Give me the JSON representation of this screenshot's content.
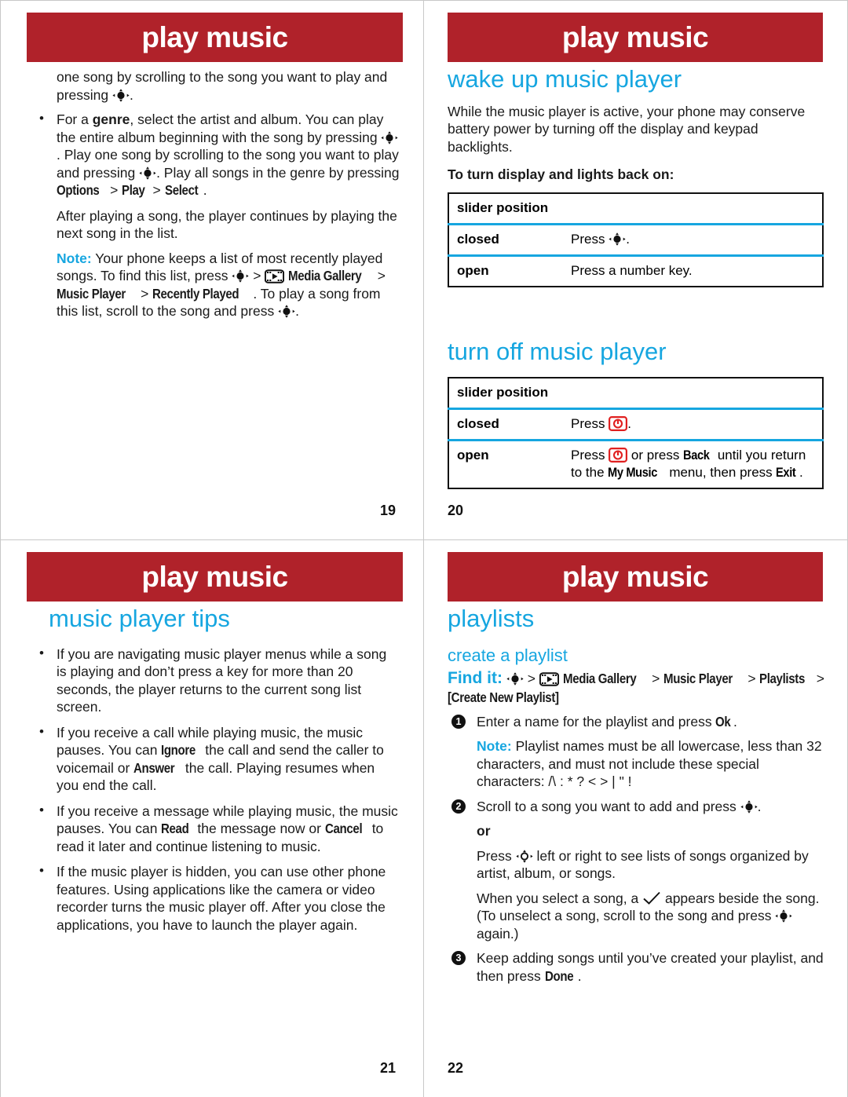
{
  "document": {
    "title": "play music",
    "colors": {
      "banner_red": "#b0222a",
      "heading_cyan": "#16a6e0",
      "rule_cyan": "#16a6e0",
      "power_key_red": "#e02020"
    }
  },
  "pages": [
    {
      "number": "19",
      "banner": "play music",
      "blocks": [
        {
          "kind": "paragraph",
          "runs": [
            {
              "t": "text",
              "v": "one song by scrolling to the song you want to play and pressing "
            },
            {
              "t": "icon",
              "v": "nav-key-icon"
            },
            {
              "t": "text",
              "v": "."
            }
          ]
        },
        {
          "kind": "bullet",
          "runs": [
            {
              "t": "text",
              "v": "For a "
            },
            {
              "t": "bold",
              "v": "genre"
            },
            {
              "t": "text",
              "v": ", select the artist and album. You can play the entire album beginning with the song by pressing "
            },
            {
              "t": "icon",
              "v": "nav-key-icon"
            },
            {
              "t": "text",
              "v": ". Play one song by scrolling to the song you want to play and pressing "
            },
            {
              "t": "icon",
              "v": "nav-key-icon"
            },
            {
              "t": "text",
              "v": ". Play all songs in the genre by pressing "
            },
            {
              "t": "keycap",
              "v": "Options"
            },
            {
              "t": "text",
              "v": " > "
            },
            {
              "t": "keycap",
              "v": "Play"
            },
            {
              "t": "text",
              "v": " > "
            },
            {
              "t": "keycap",
              "v": "Select"
            },
            {
              "t": "text",
              "v": "."
            }
          ]
        },
        {
          "kind": "paragraph-indent",
          "runs": [
            {
              "t": "text",
              "v": "After playing a song, the player continues by playing the next song in the list."
            }
          ]
        },
        {
          "kind": "paragraph-indent",
          "runs": [
            {
              "t": "note",
              "v": "Note:"
            },
            {
              "t": "text",
              "v": " Your phone keeps a list of most recently played songs. To find this list, press "
            },
            {
              "t": "icon",
              "v": "nav-key-icon"
            },
            {
              "t": "text",
              "v": " > "
            },
            {
              "t": "icon",
              "v": "media-gallery-icon"
            },
            {
              "t": "text",
              "v": " "
            },
            {
              "t": "keycap",
              "v": "Media Gallery"
            },
            {
              "t": "text",
              "v": " > "
            },
            {
              "t": "keycap",
              "v": "Music Player"
            },
            {
              "t": "text",
              "v": " > "
            },
            {
              "t": "keycap",
              "v": "Recently Played"
            },
            {
              "t": "text",
              "v": ". To play a song from this list, scroll to the song and press "
            },
            {
              "t": "icon",
              "v": "nav-key-icon"
            },
            {
              "t": "text",
              "v": "."
            }
          ]
        }
      ]
    },
    {
      "number": "20",
      "banner": "play music",
      "heading1": "wake up music player",
      "intro": "While the music player is active, your phone may conserve battery power by turning off the display and keypad backlights.",
      "subhead": "To turn display and lights back on:",
      "table1": {
        "header": "slider position",
        "rows": [
          {
            "label": "closed",
            "runs": [
              {
                "t": "text",
                "v": "Press "
              },
              {
                "t": "icon",
                "v": "nav-key-icon"
              },
              {
                "t": "text",
                "v": "."
              }
            ]
          },
          {
            "label": "open",
            "runs": [
              {
                "t": "text",
                "v": "Press a number key."
              }
            ]
          }
        ]
      },
      "heading2": "turn off music player",
      "table2": {
        "header": "slider position",
        "rows": [
          {
            "label": "closed",
            "runs": [
              {
                "t": "text",
                "v": "Press "
              },
              {
                "t": "icon",
                "v": "power-key-icon"
              },
              {
                "t": "text",
                "v": "."
              }
            ]
          },
          {
            "label": "open",
            "runs": [
              {
                "t": "text",
                "v": "Press "
              },
              {
                "t": "icon",
                "v": "power-key-icon"
              },
              {
                "t": "text",
                "v": " or press "
              },
              {
                "t": "keycap",
                "v": "Back"
              },
              {
                "t": "text",
                "v": " until you return to the "
              },
              {
                "t": "keycap",
                "v": "My Music"
              },
              {
                "t": "text",
                "v": " menu, then press "
              },
              {
                "t": "keycap",
                "v": "Exit"
              },
              {
                "t": "text",
                "v": "."
              }
            ]
          }
        ]
      }
    },
    {
      "number": "21",
      "banner": "play music",
      "heading1": "music player tips",
      "bullets": [
        {
          "runs": [
            {
              "t": "text",
              "v": "If you are navigating music player menus while a song is playing and don’t press a key for more than 20 seconds, the player returns to the current song list screen."
            }
          ]
        },
        {
          "runs": [
            {
              "t": "text",
              "v": "If you receive a call while playing music, the music pauses. You can "
            },
            {
              "t": "keycap",
              "v": "Ignore"
            },
            {
              "t": "text",
              "v": " the call and send the caller to voicemail or "
            },
            {
              "t": "keycap",
              "v": "Answer"
            },
            {
              "t": "text",
              "v": " the call. Playing resumes when you end the call."
            }
          ]
        },
        {
          "runs": [
            {
              "t": "text",
              "v": "If you receive a message while playing music, the music pauses. You can "
            },
            {
              "t": "keycap",
              "v": "Read"
            },
            {
              "t": "text",
              "v": " the message now or "
            },
            {
              "t": "keycap",
              "v": "Cancel"
            },
            {
              "t": "text",
              "v": " to read it later and continue listening to music."
            }
          ]
        },
        {
          "runs": [
            {
              "t": "text",
              "v": "If the music player is hidden, you can use other phone features. Using applications like the camera or video recorder turns the music player off. After you close the applications, you have to launch the player again."
            }
          ]
        }
      ]
    },
    {
      "number": "22",
      "banner": "play music",
      "heading1": "playlists",
      "heading2": "create a playlist",
      "find_it": {
        "label": "Find it:",
        "runs": [
          {
            "t": "icon",
            "v": "nav-key-icon"
          },
          {
            "t": "text",
            "v": " > "
          },
          {
            "t": "icon",
            "v": "media-gallery-icon"
          },
          {
            "t": "text",
            "v": " "
          },
          {
            "t": "keycap",
            "v": "Media Gallery"
          },
          {
            "t": "text",
            "v": " > "
          },
          {
            "t": "keycap",
            "v": "Music Player"
          },
          {
            "t": "text",
            "v": " > "
          },
          {
            "t": "keycap",
            "v": "Playlists"
          },
          {
            "t": "text",
            "v": " > "
          },
          {
            "t": "keycap",
            "v": "[Create New Playlist]"
          }
        ]
      },
      "steps": [
        {
          "num": "1",
          "runs": [
            {
              "t": "text",
              "v": "Enter a name for the playlist and press "
            },
            {
              "t": "keycap",
              "v": "Ok"
            },
            {
              "t": "text",
              "v": "."
            }
          ],
          "sub": [
            {
              "runs": [
                {
                  "t": "note",
                  "v": "Note:"
                },
                {
                  "t": "text",
                  "v": " Playlist names must be all lowercase, less than 32 characters, and must not include these special characters: /\\ : * ? < > | \" !"
                }
              ]
            }
          ]
        },
        {
          "num": "2",
          "runs": [
            {
              "t": "text",
              "v": "Scroll to a song you want to add and press "
            },
            {
              "t": "icon",
              "v": "nav-key-icon"
            },
            {
              "t": "text",
              "v": "."
            }
          ],
          "sub": [
            {
              "runs": [
                {
                  "t": "bold",
                  "v": "or"
                }
              ]
            },
            {
              "runs": [
                {
                  "t": "text",
                  "v": "Press "
                },
                {
                  "t": "icon",
                  "v": "nav-key-ring-icon"
                },
                {
                  "t": "text",
                  "v": " left or right to see lists of songs organized by artist, album, or songs."
                }
              ]
            },
            {
              "runs": [
                {
                  "t": "text",
                  "v": "When you select a song, a "
                },
                {
                  "t": "icon",
                  "v": "checkmark-icon"
                },
                {
                  "t": "text",
                  "v": " appears beside the song. (To unselect a song, scroll to the song and press "
                },
                {
                  "t": "icon",
                  "v": "nav-key-icon"
                },
                {
                  "t": "text",
                  "v": " again.)"
                }
              ]
            }
          ]
        },
        {
          "num": "3",
          "runs": [
            {
              "t": "text",
              "v": "Keep adding songs until you’ve created your playlist, and then press "
            },
            {
              "t": "keycap",
              "v": "Done"
            },
            {
              "t": "text",
              "v": "."
            }
          ],
          "sub": []
        }
      ]
    }
  ]
}
